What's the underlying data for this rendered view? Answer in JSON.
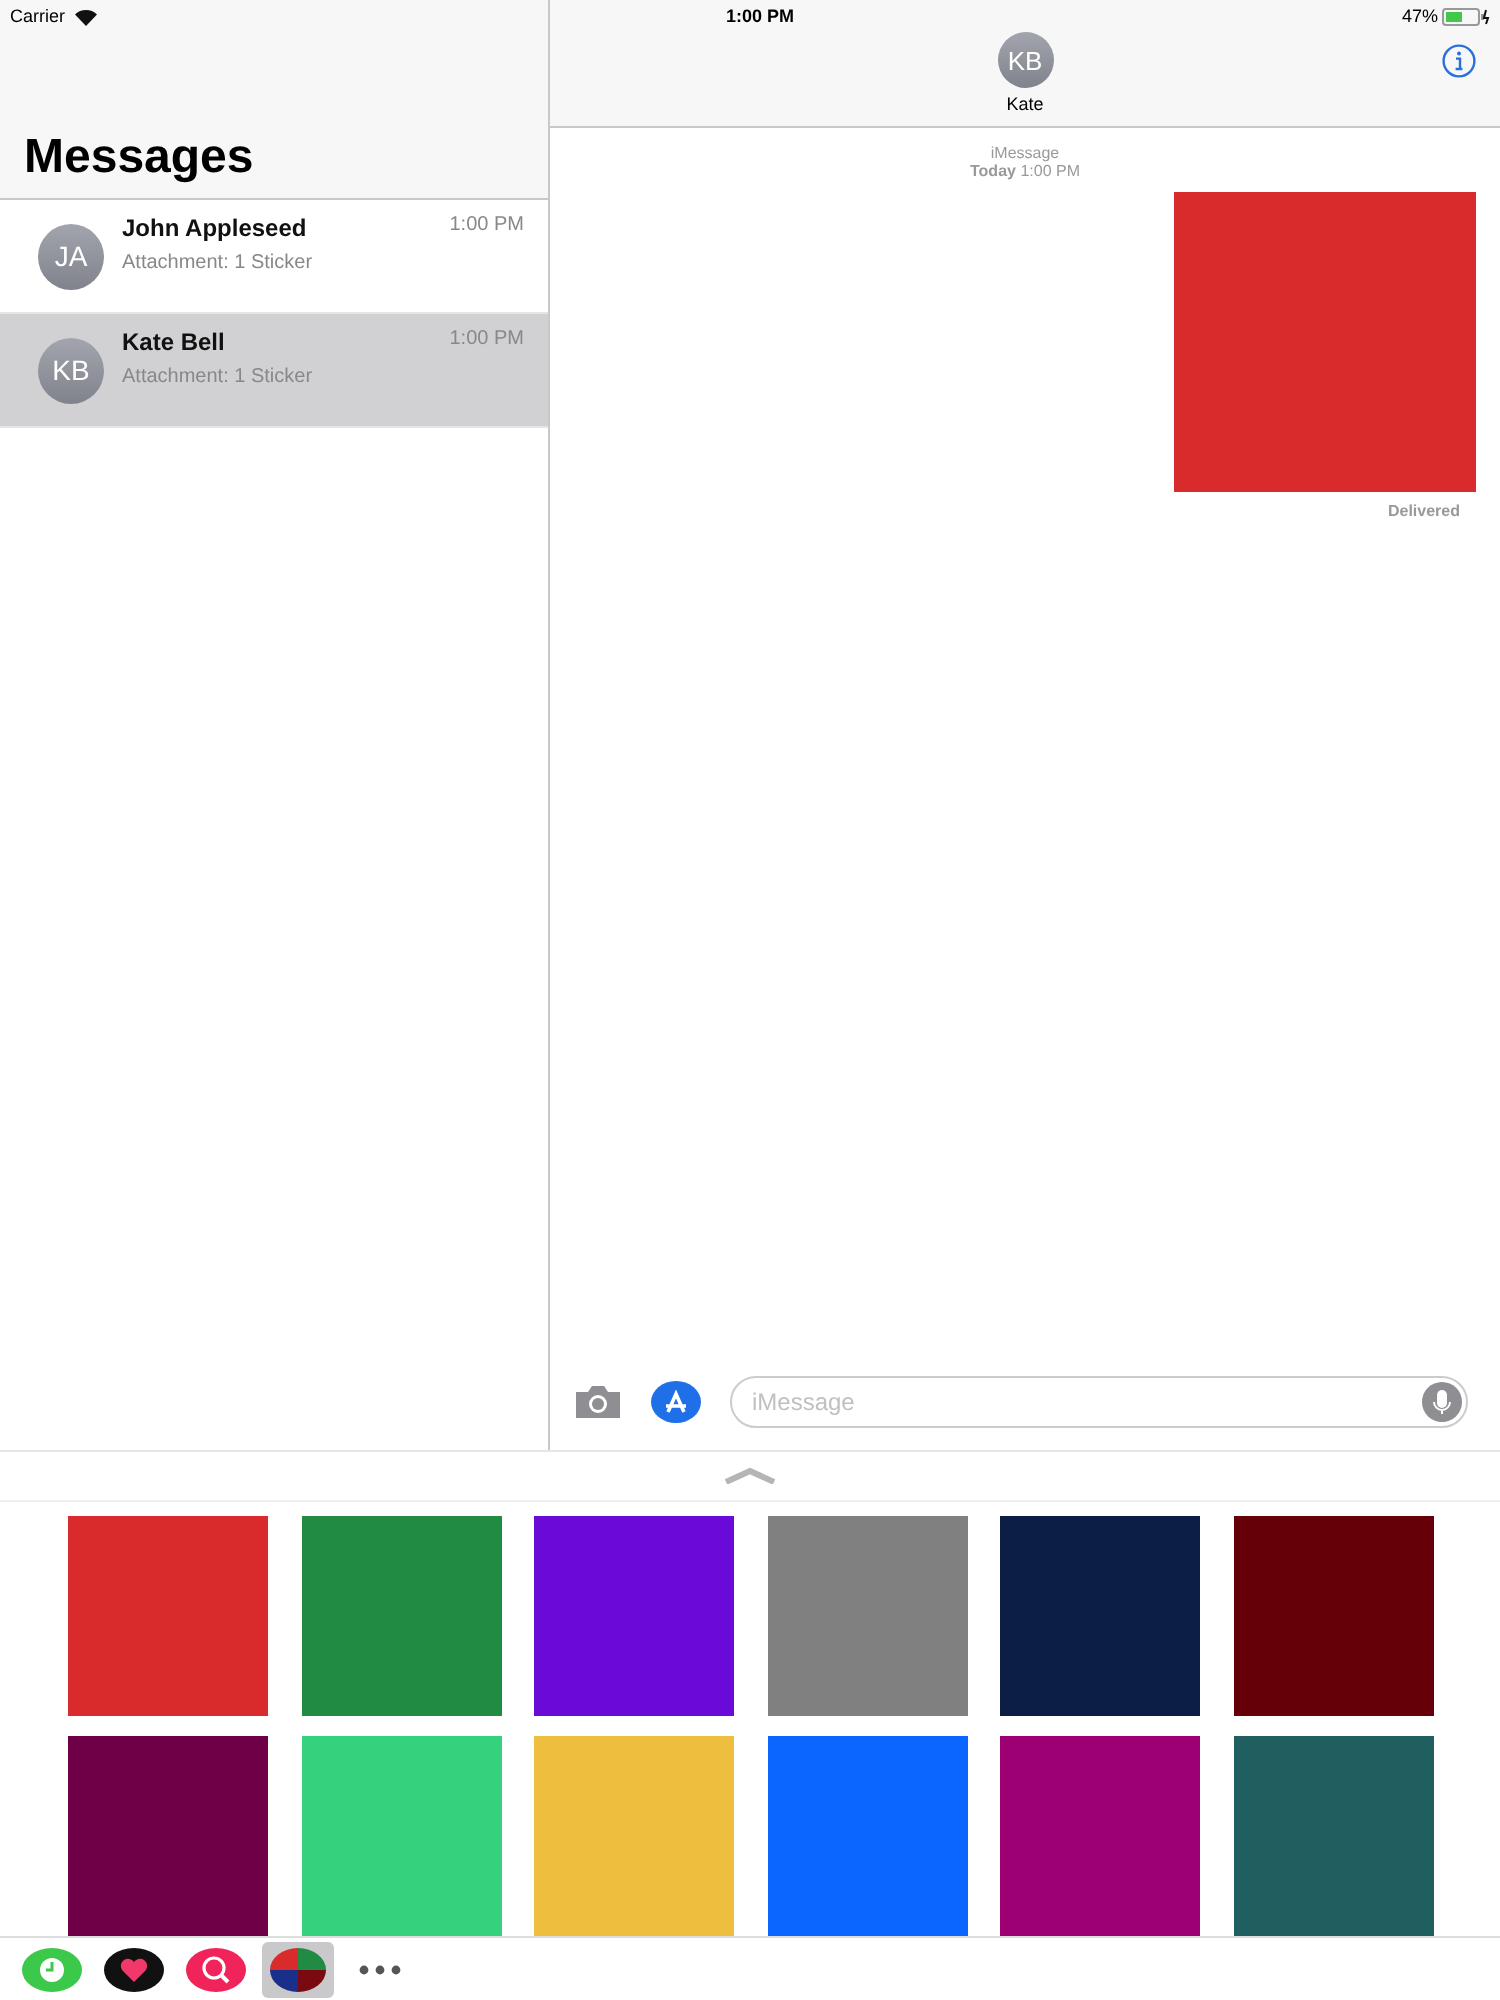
{
  "status_bar": {
    "carrier": "Carrier",
    "time": "1:00 PM",
    "battery": "47%"
  },
  "sidebar": {
    "title": "Messages",
    "conversations": [
      {
        "initials": "JA",
        "name": "John Appleseed",
        "preview": "Attachment: 1 Sticker",
        "time": "1:00 PM",
        "selected": false
      },
      {
        "initials": "KB",
        "name": "Kate Bell",
        "preview": "Attachment: 1 Sticker",
        "time": "1:00 PM",
        "selected": true
      }
    ]
  },
  "chat": {
    "contact_initials": "KB",
    "contact_name": "Kate",
    "service": "iMessage",
    "timestamp_day": "Today",
    "timestamp_time": "1:00 PM",
    "sticker": {
      "color": "#d92b2b"
    },
    "status": "Delivered",
    "input_placeholder": "iMessage"
  },
  "sticker_grid": [
    {
      "color": "#d92b2b"
    },
    {
      "color": "#218a43"
    },
    {
      "color": "#6a0ad9"
    },
    {
      "color": "#808080"
    },
    {
      "color": "#0c1e45"
    },
    {
      "color": "#660008"
    },
    {
      "color": "#6e0047"
    },
    {
      "color": "#36d17d"
    },
    {
      "color": "#eebf3f"
    },
    {
      "color": "#0a66ff"
    },
    {
      "color": "#9c0073"
    },
    {
      "color": "#1f5f5f"
    }
  ],
  "app_tray": [
    {
      "kind": "clock",
      "selected": false
    },
    {
      "kind": "heart",
      "selected": false
    },
    {
      "kind": "search",
      "selected": false
    },
    {
      "kind": "grid",
      "selected": true
    },
    {
      "kind": "more",
      "selected": false
    }
  ]
}
